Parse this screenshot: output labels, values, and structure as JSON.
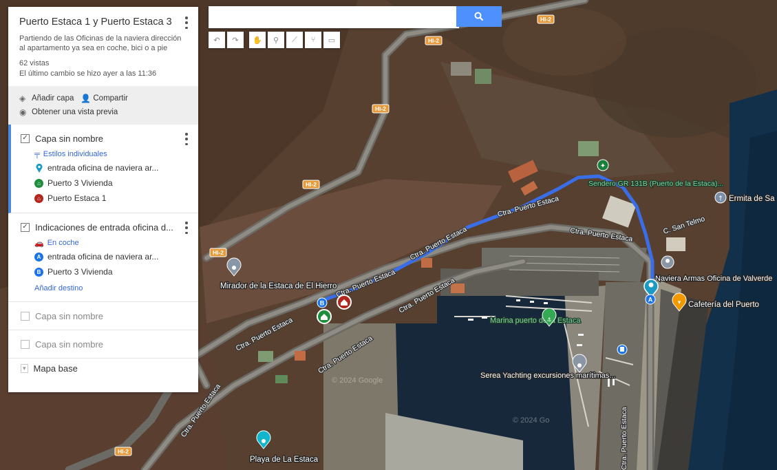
{
  "panel": {
    "title": "Puerto Estaca 1 y Puerto Estaca 3",
    "description": "Partiendo de las Oficinas de la naviera dirección al apartamento ya sea en coche, bici o a pie",
    "views": "62 vistas",
    "last_change": "El último cambio se hizo ayer a las 11:36",
    "add_layer": "Añadir capa",
    "share": "Compartir",
    "preview": "Obtener una vista previa",
    "layer1": {
      "name": "Capa sin nombre",
      "style": "Estilos individuales",
      "items": [
        {
          "label": "entrada oficina de naviera ar...",
          "color": "#1a9bc4"
        },
        {
          "label": "Puerto 3 Vivienda",
          "color": "#1e8e3e"
        },
        {
          "label": "Puerto Estaca 1",
          "color": "#b3261e"
        }
      ]
    },
    "layer2": {
      "name": "Indicaciones de entrada oficina d...",
      "mode": "En coche",
      "items": [
        {
          "letter": "A",
          "label": "entrada oficina de naviera ar..."
        },
        {
          "letter": "B",
          "label": "Puerto 3 Vivienda"
        }
      ],
      "add_destination": "Añadir destino"
    },
    "layer3": {
      "name": "Capa sin nombre"
    },
    "layer4": {
      "name": "Capa sin nombre"
    },
    "base_map": "Mapa base"
  },
  "search": {
    "value": "",
    "placeholder": ""
  },
  "toolbar": [
    "undo-icon",
    "redo-icon",
    "hand-icon",
    "marker-icon",
    "draw-line-icon",
    "directions-icon",
    "ruler-icon"
  ],
  "map": {
    "road_shields": [
      "HI-2",
      "HI-2",
      "HI-2",
      "HI-2",
      "HI-2",
      "HI-2"
    ],
    "road_labels": [
      "Ctra. Puerto Estaca",
      "Ctra. Puerto Estaca",
      "Ctra. Puerto Estaca",
      "Ctra. Puerto Estaca",
      "Ctra. Puerto Estaca",
      "Ctra. Puerto Estaca",
      "Ctra. Puerto Estaca",
      "Ctra. Puerto Estaca",
      "Ctra. Puerto Estaca"
    ],
    "street_label": "C. San Telmo",
    "places": {
      "sendero": "Sendero GR 131B (Puerto de la Estaca)...",
      "ermita": "Ermita de Sa",
      "naviera": "Naviera Armas Oficina de Valverde",
      "cafeteria": "Cafetería del Puerto",
      "mirador": "Mirador de la Estaca de El Hierro",
      "marina": "Marina puerto de la Estaca",
      "serea": "Serea Yachting excursiones marítimas...",
      "playa": "Playa de La Estaca"
    },
    "watermarks": [
      "© 2024 Google",
      "© 2024 Go"
    ],
    "route_color": "#3a6ee8",
    "marker_a": "A",
    "marker_b": "B"
  }
}
